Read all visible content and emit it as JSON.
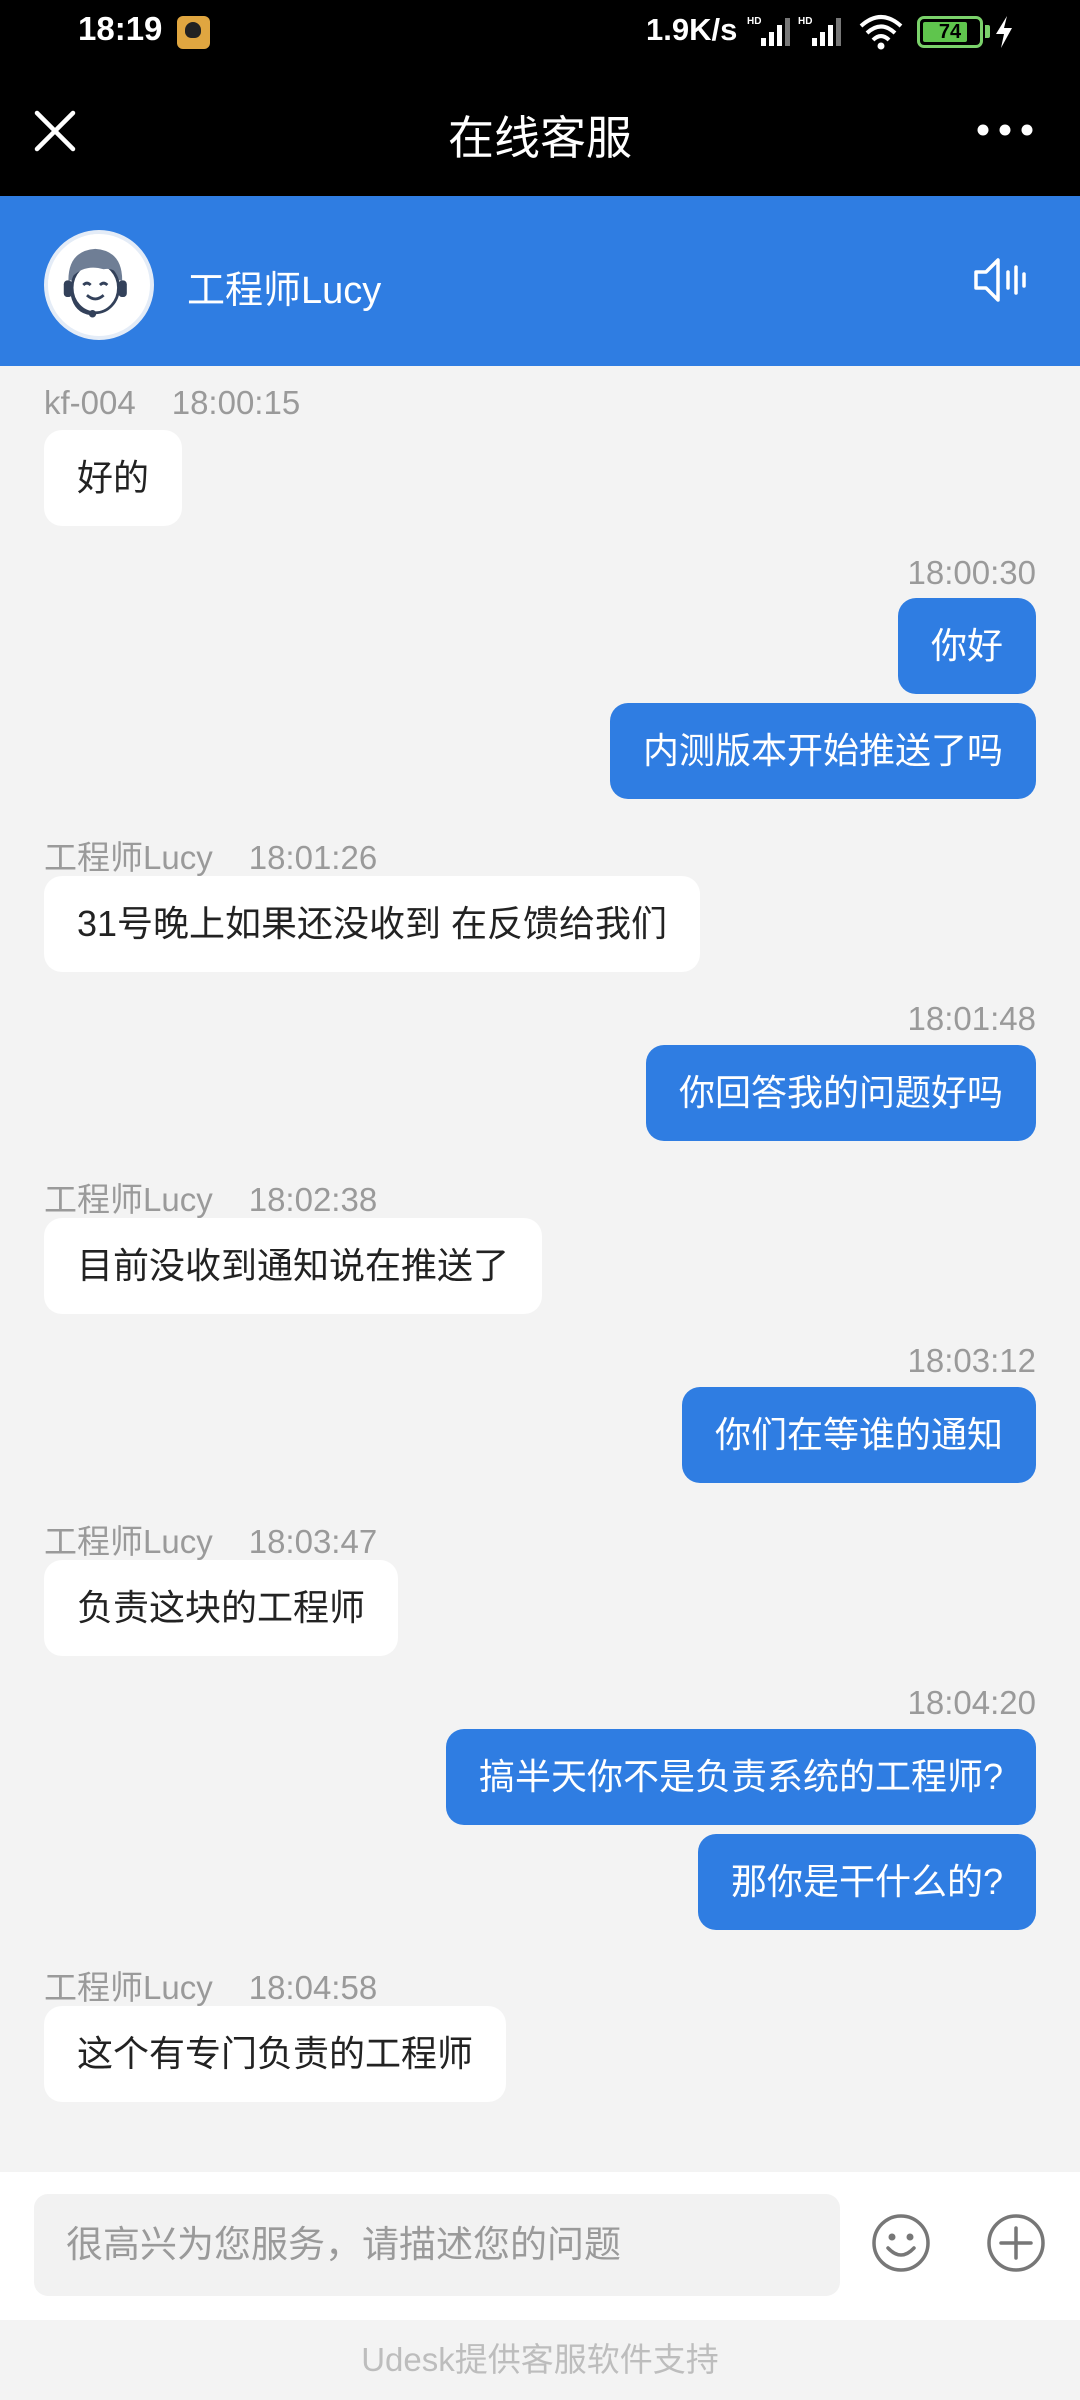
{
  "status_bar": {
    "time": "18:19",
    "net_speed": "1.9K/s",
    "battery": "74",
    "app_icon": "camera-app-icon",
    "icons": [
      "hd-signal-icon",
      "hd-signal-icon",
      "wifi-icon",
      "battery-icon",
      "charging-bolt-icon"
    ]
  },
  "titlebar": {
    "title": "在线客服",
    "close_icon": "close-icon",
    "more_icon": "more-dots-icon"
  },
  "agent": {
    "name": "工程师Lucy",
    "avatar_icon": "agent-headset-avatar",
    "speaker_icon": "speaker-icon",
    "accent": "#2f7de2"
  },
  "messages": [
    {
      "side": "in",
      "sender": "kf-004",
      "time": "18:00:15",
      "text": "好的"
    },
    {
      "side": "out",
      "time": "18:00:30",
      "text": "你好"
    },
    {
      "side": "out",
      "text": "内测版本开始推送了吗"
    },
    {
      "side": "in",
      "sender": "工程师Lucy",
      "time": "18:01:26",
      "text": "31号晚上如果还没收到 在反馈给我们"
    },
    {
      "side": "out",
      "time": "18:01:48",
      "text": "你回答我的问题好吗"
    },
    {
      "side": "in",
      "sender": "工程师Lucy",
      "time": "18:02:38",
      "text": "目前没收到通知说在推送了"
    },
    {
      "side": "out",
      "time": "18:03:12",
      "text": "你们在等谁的通知"
    },
    {
      "side": "in",
      "sender": "工程师Lucy",
      "time": "18:03:47",
      "text": "负责这块的工程师"
    },
    {
      "side": "out",
      "time": "18:04:20",
      "text": "搞半天你不是负责系统的工程师?"
    },
    {
      "side": "out",
      "text": "那你是干什么的?"
    },
    {
      "side": "in",
      "sender": "工程师Lucy",
      "time": "18:04:58",
      "text": "这个有专门负责的工程师"
    }
  ],
  "input": {
    "placeholder": "很高兴为您服务，请描述您的问题",
    "value": "",
    "emoji_icon": "emoji-icon",
    "plus_icon": "plus-icon"
  },
  "footer": {
    "text": "Udesk提供客服软件支持"
  }
}
